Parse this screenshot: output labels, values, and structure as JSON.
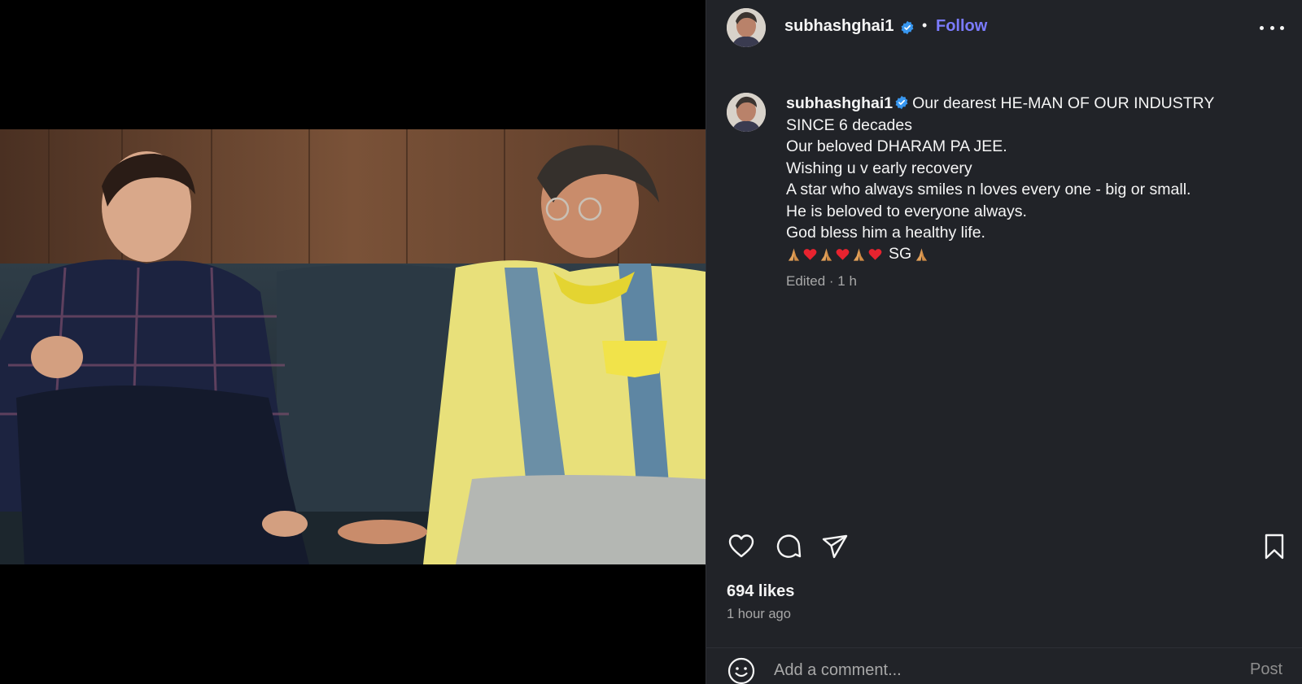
{
  "post": {
    "username": "subhashghai1",
    "follow_label": "Follow",
    "separator": "•",
    "caption_lines": [
      "Our dearest HE-MAN OF OUR INDUSTRY",
      "SINCE 6 decades",
      "Our beloved DHARAM PA JEE.",
      "Wishing u v early recovery",
      "A star who always smiles n loves every one - big or small.",
      "He is beloved to everyone always.",
      "God bless him a healthy life."
    ],
    "caption_sign": "SG",
    "edited_label": "Edited · 1 h",
    "likes": "694 likes",
    "posted_time": "1 hour ago"
  },
  "comment": {
    "placeholder": "Add a comment...",
    "post_label": "Post"
  },
  "icons": {
    "verified": "verified-badge-icon",
    "more": "more-options-icon",
    "like": "heart-icon",
    "comment": "comment-bubble-icon",
    "share": "paper-plane-icon",
    "save": "bookmark-icon",
    "emoji": "smiley-icon"
  },
  "colors": {
    "panel_bg": "#212328",
    "follow_link": "#7b7bff",
    "verified": "#3897f0",
    "muted_text": "#a8a8a8"
  }
}
